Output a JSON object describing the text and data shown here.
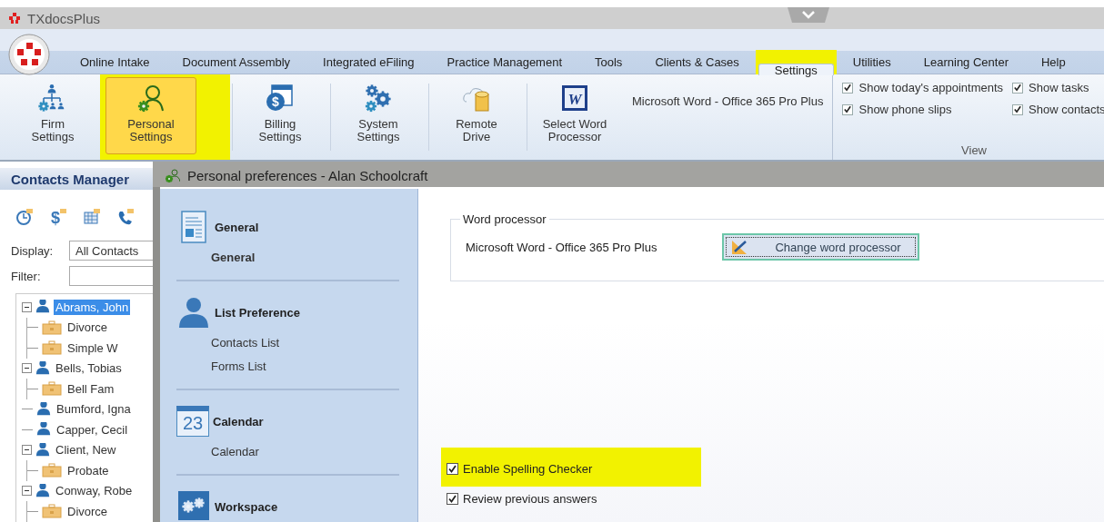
{
  "app": {
    "title": "TXdocsPlus"
  },
  "tabs": [
    {
      "label": "Online Intake",
      "selected": false
    },
    {
      "label": "Document Assembly",
      "selected": false
    },
    {
      "label": "Integrated eFiling",
      "selected": false
    },
    {
      "label": "Practice Management",
      "selected": false
    },
    {
      "label": "Tools",
      "selected": false
    },
    {
      "label": "Clients & Cases",
      "selected": false
    },
    {
      "label": "Settings",
      "selected": true,
      "highlighted": true
    },
    {
      "label": "Utilities",
      "selected": false
    },
    {
      "label": "Learning Center",
      "selected": false
    },
    {
      "label": "Help",
      "selected": false
    }
  ],
  "ribbon": {
    "buttons": [
      {
        "label": "Firm Settings",
        "kind": "firm",
        "selected": false
      },
      {
        "label": "Personal Settings",
        "kind": "personal",
        "selected": true,
        "highlighted": true
      },
      {
        "label": "Billing Settings",
        "kind": "billing",
        "glyph": "$",
        "selected": false
      },
      {
        "label": "System Settings",
        "kind": "system",
        "selected": false
      },
      {
        "label": "Remote Drive",
        "kind": "drive",
        "selected": false
      },
      {
        "label": "Select Word Processor",
        "kind": "word",
        "glyph": "W",
        "selected": false
      }
    ],
    "word_processor": "Microsoft Word - Office 365 Pro Plus",
    "view": {
      "label": "View",
      "options": [
        {
          "label": "Show today's appointments",
          "checked": true
        },
        {
          "label": "Show tasks",
          "checked": true
        },
        {
          "label": "Show phone slips",
          "checked": true
        },
        {
          "label": "Show contacts",
          "checked": true
        }
      ]
    }
  },
  "contacts": {
    "title": "Contacts Manager",
    "tools": [
      {
        "kind": "clock"
      },
      {
        "kind": "dollar",
        "glyph": "$"
      },
      {
        "kind": "calendar"
      },
      {
        "kind": "phone"
      }
    ],
    "display_label": "Display:",
    "display_value": "All Contacts",
    "filter_label": "Filter:",
    "tree": [
      {
        "label": "Abrams, John",
        "selected": true,
        "expanded": true,
        "children": [
          {
            "label": "Divorce",
            "selected": false
          },
          {
            "label": "Simple W",
            "selected": false
          }
        ]
      },
      {
        "label": "Bells, Tobias",
        "selected": false,
        "expanded": true,
        "children": [
          {
            "label": "Bell Fam",
            "selected": false
          }
        ]
      },
      {
        "label": "Bumford, Igna",
        "selected": false,
        "expanded": false
      },
      {
        "label": "Capper, Cecil",
        "selected": false,
        "expanded": false
      },
      {
        "label": "Client, New",
        "selected": false,
        "expanded": true,
        "children": [
          {
            "label": "Probate",
            "selected": false
          }
        ]
      },
      {
        "label": "Conway, Robe",
        "selected": false,
        "expanded": true,
        "children": [
          {
            "label": "Divorce",
            "selected": false
          }
        ]
      }
    ]
  },
  "dialog": {
    "title": "Personal preferences - Alan Schoolcraft",
    "nav": [
      {
        "heading": "General",
        "kind": "document",
        "items": [
          {
            "label": "General",
            "selected": true
          }
        ]
      },
      {
        "heading": "List Preference",
        "kind": "person",
        "items": [
          {
            "label": "Contacts List",
            "selected": false
          },
          {
            "label": "Forms List",
            "selected": false
          }
        ]
      },
      {
        "heading": "Calendar",
        "kind": "calendar",
        "day": "23",
        "items": [
          {
            "label": "Calendar",
            "selected": false
          }
        ]
      },
      {
        "heading": "Workspace",
        "kind": "workspace"
      }
    ],
    "group": {
      "legend": "Word processor",
      "value": "Microsoft Word - Office 365 Pro Plus",
      "button": "Change word processor"
    },
    "options": [
      {
        "label": "Enable Spelling Checker",
        "checked": true,
        "highlighted": true
      },
      {
        "label": "Review previous answers",
        "checked": true,
        "highlighted": false
      }
    ]
  }
}
